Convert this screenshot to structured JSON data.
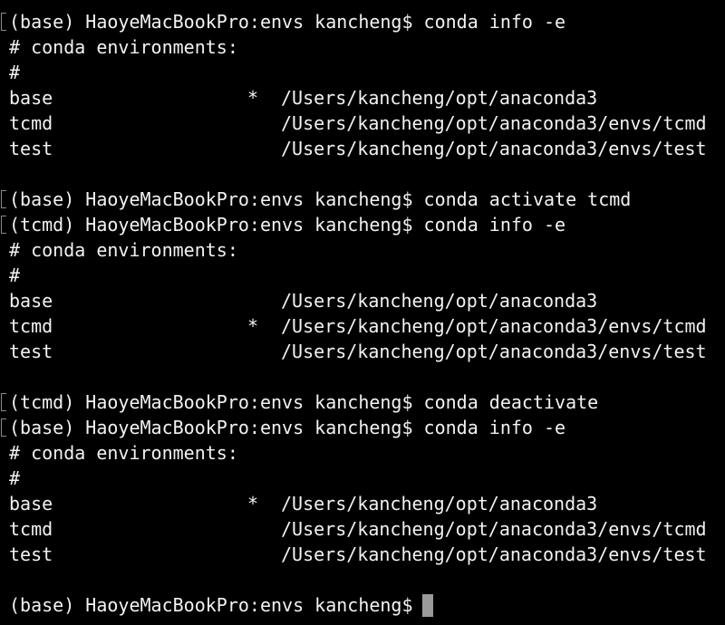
{
  "terminal": {
    "lines": [
      {
        "kind": "cmd",
        "mark": true,
        "text": "(base) HaoyeMacBookPro:envs kancheng$ conda info -e"
      },
      {
        "kind": "text",
        "text": "# conda environments:"
      },
      {
        "kind": "text",
        "text": "#"
      },
      {
        "kind": "env",
        "name": "base",
        "star": "*",
        "path": "/Users/kancheng/opt/anaconda3"
      },
      {
        "kind": "env",
        "name": "tcmd",
        "star": "",
        "path": "/Users/kancheng/opt/anaconda3/envs/tcmd"
      },
      {
        "kind": "env",
        "name": "test",
        "star": "",
        "path": "/Users/kancheng/opt/anaconda3/envs/test"
      },
      {
        "kind": "blank"
      },
      {
        "kind": "cmd",
        "mark": true,
        "text": "(base) HaoyeMacBookPro:envs kancheng$ conda activate tcmd"
      },
      {
        "kind": "cmd",
        "mark": true,
        "text": "(tcmd) HaoyeMacBookPro:envs kancheng$ conda info -e"
      },
      {
        "kind": "text",
        "text": "# conda environments:"
      },
      {
        "kind": "text",
        "text": "#"
      },
      {
        "kind": "env",
        "name": "base",
        "star": "",
        "path": "/Users/kancheng/opt/anaconda3"
      },
      {
        "kind": "env",
        "name": "tcmd",
        "star": "*",
        "path": "/Users/kancheng/opt/anaconda3/envs/tcmd"
      },
      {
        "kind": "env",
        "name": "test",
        "star": "",
        "path": "/Users/kancheng/opt/anaconda3/envs/test"
      },
      {
        "kind": "blank"
      },
      {
        "kind": "cmd",
        "mark": true,
        "text": "(tcmd) HaoyeMacBookPro:envs kancheng$ conda deactivate"
      },
      {
        "kind": "cmd",
        "mark": true,
        "text": "(base) HaoyeMacBookPro:envs kancheng$ conda info -e"
      },
      {
        "kind": "text",
        "text": "# conda environments:"
      },
      {
        "kind": "text",
        "text": "#"
      },
      {
        "kind": "env",
        "name": "base",
        "star": "*",
        "path": "/Users/kancheng/opt/anaconda3"
      },
      {
        "kind": "env",
        "name": "tcmd",
        "star": "",
        "path": "/Users/kancheng/opt/anaconda3/envs/tcmd"
      },
      {
        "kind": "env",
        "name": "test",
        "star": "",
        "path": "/Users/kancheng/opt/anaconda3/envs/test"
      },
      {
        "kind": "blank"
      },
      {
        "kind": "prompt",
        "mark": false,
        "text": "(base) HaoyeMacBookPro:envs kancheng$ "
      }
    ]
  },
  "colors": {
    "background": "#000000",
    "text": "#f2f2f2",
    "cursor": "#9a9a9a",
    "mark": "#8a8a8a"
  }
}
